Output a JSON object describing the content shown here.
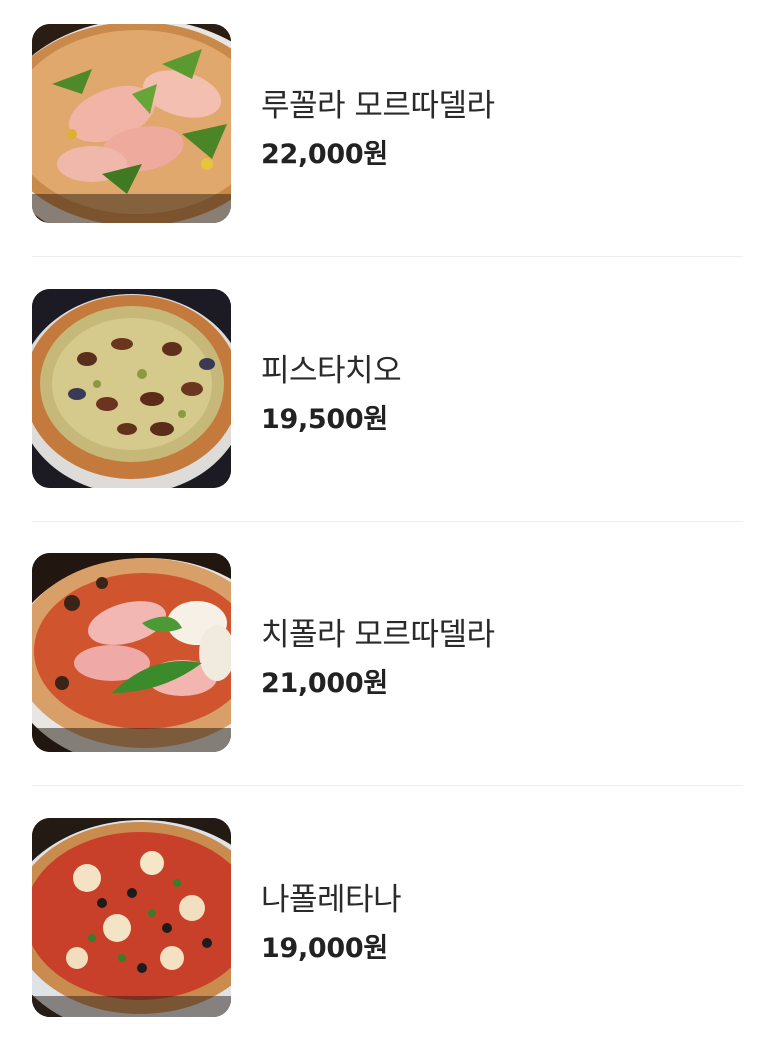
{
  "menu": {
    "items": [
      {
        "name": "루꼴라 모르따델라",
        "price": "22,000원",
        "image": "rucola-mortadella-pizza-photo"
      },
      {
        "name": "피스타치오",
        "price": "19,500원",
        "image": "pistachio-pizza-photo"
      },
      {
        "name": "치폴라 모르따델라",
        "price": "21,000원",
        "image": "cipolla-mortadella-pizza-photo"
      },
      {
        "name": "나폴레타나",
        "price": "19,000원",
        "image": "napoletana-pizza-photo"
      }
    ]
  },
  "colors": {
    "divider": "#eceef0",
    "name_text": "#2a2a2a",
    "price_text": "#222222"
  }
}
